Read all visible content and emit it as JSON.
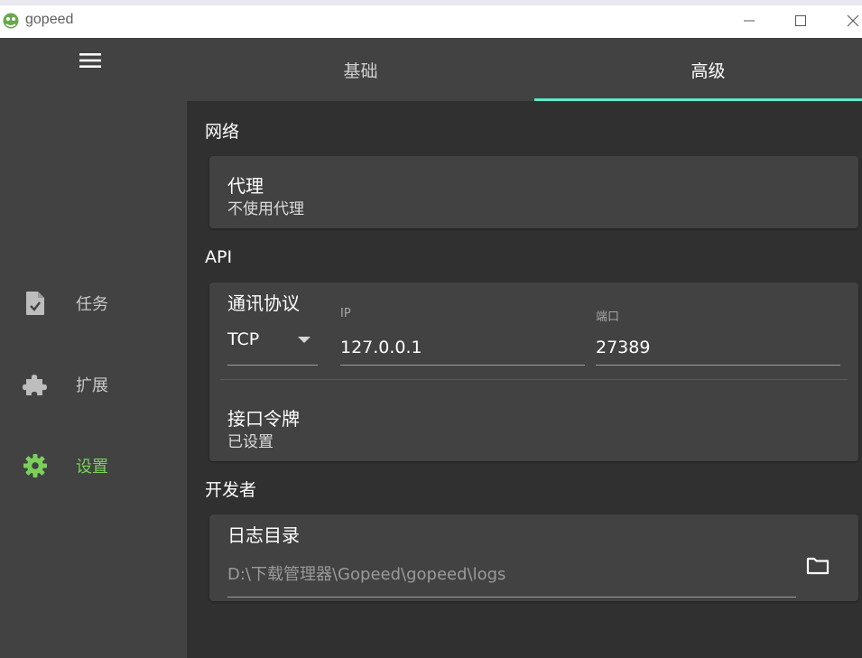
{
  "window": {
    "title": "gopeed",
    "accent_color": "#5eebc9",
    "active_nav_color": "#7ad05a"
  },
  "sidebar": {
    "menu_icon": "menu-icon",
    "items": [
      {
        "label": "任务",
        "icon": "task-file-icon",
        "active": false
      },
      {
        "label": "扩展",
        "icon": "puzzle-icon",
        "active": false
      },
      {
        "label": "设置",
        "icon": "gear-icon",
        "active": true
      }
    ]
  },
  "tabs": [
    {
      "label": "基础",
      "active": false
    },
    {
      "label": "高级",
      "active": true
    }
  ],
  "sections": {
    "network": {
      "title": "网络",
      "proxy": {
        "title": "代理",
        "value": "不使用代理"
      }
    },
    "api": {
      "title": "API",
      "protocol": {
        "title": "通讯协议",
        "selected": "TCP"
      },
      "ip": {
        "label": "IP",
        "value": "127.0.0.1"
      },
      "port": {
        "label": "端口",
        "value": "27389"
      },
      "token": {
        "title": "接口令牌",
        "value": "已设置"
      }
    },
    "developer": {
      "title": "开发者",
      "log_dir": {
        "title": "日志目录",
        "value": "D:\\下载管理器\\Gopeed\\gopeed\\logs"
      }
    }
  }
}
